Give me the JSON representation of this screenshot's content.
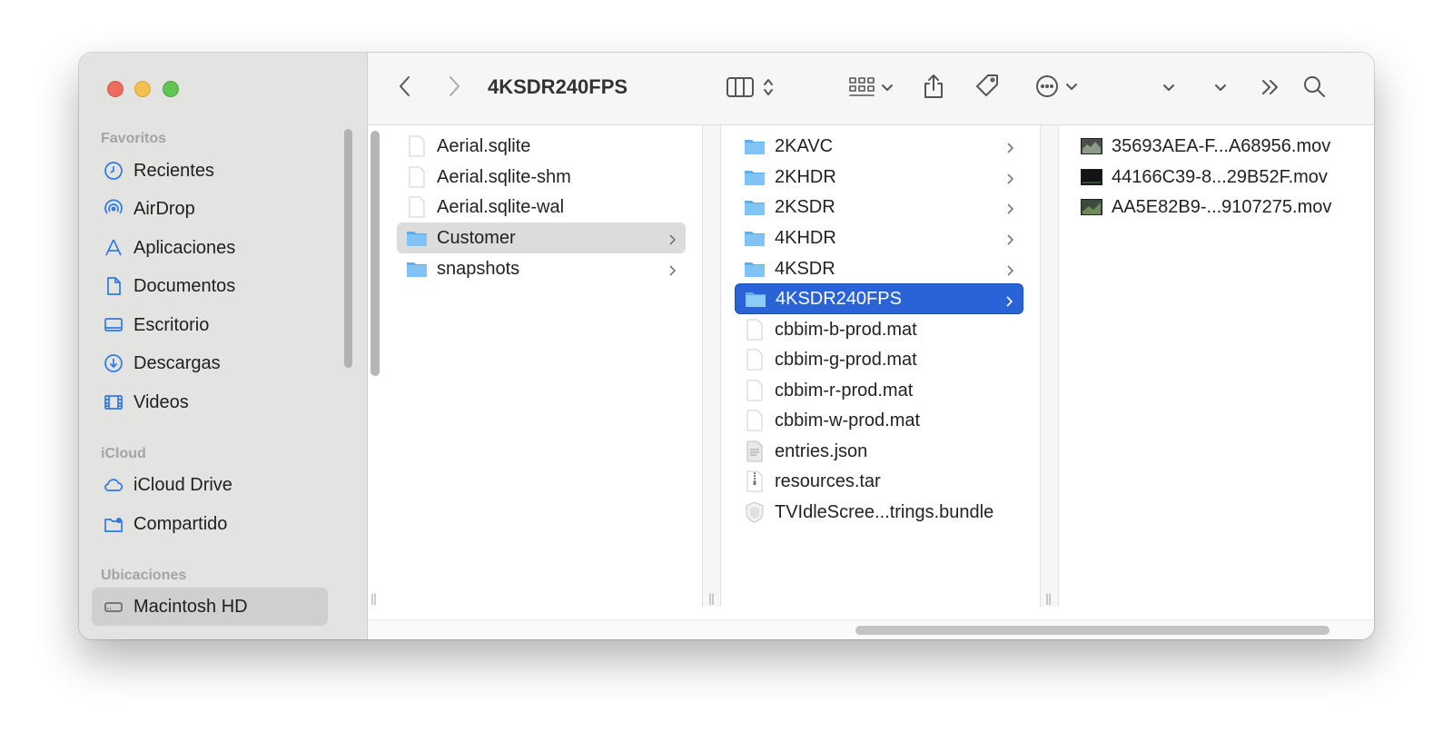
{
  "window": {
    "title": "4KSDR240FPS"
  },
  "sidebar": {
    "sections": [
      {
        "label": "Favoritos",
        "items": [
          {
            "label": "Recientes",
            "icon": "clock-icon"
          },
          {
            "label": "AirDrop",
            "icon": "airdrop-icon"
          },
          {
            "label": "Aplicaciones",
            "icon": "applications-icon"
          },
          {
            "label": "Documentos",
            "icon": "document-icon"
          },
          {
            "label": "Escritorio",
            "icon": "desktop-icon"
          },
          {
            "label": "Descargas",
            "icon": "download-icon"
          },
          {
            "label": "Videos",
            "icon": "film-icon"
          }
        ]
      },
      {
        "label": "iCloud",
        "items": [
          {
            "label": "iCloud Drive",
            "icon": "cloud-icon"
          },
          {
            "label": "Compartido",
            "icon": "shared-folder-icon"
          }
        ]
      },
      {
        "label": "Ubicaciones",
        "items": [
          {
            "label": "Macintosh HD",
            "icon": "hard-drive-icon",
            "selected": true
          }
        ]
      }
    ]
  },
  "columns": [
    {
      "items": [
        {
          "name": "Aerial.sqlite",
          "type": "file"
        },
        {
          "name": "Aerial.sqlite-shm",
          "type": "file"
        },
        {
          "name": "Aerial.sqlite-wal",
          "type": "file"
        },
        {
          "name": "Customer",
          "type": "folder",
          "state": "path"
        },
        {
          "name": "snapshots",
          "type": "folder"
        }
      ]
    },
    {
      "items": [
        {
          "name": "2KAVC",
          "type": "folder"
        },
        {
          "name": "2KHDR",
          "type": "folder"
        },
        {
          "name": "2KSDR",
          "type": "folder"
        },
        {
          "name": "4KHDR",
          "type": "folder"
        },
        {
          "name": "4KSDR",
          "type": "folder"
        },
        {
          "name": "4KSDR240FPS",
          "type": "folder",
          "state": "selected"
        },
        {
          "name": "cbbim-b-prod.mat",
          "type": "file"
        },
        {
          "name": "cbbim-g-prod.mat",
          "type": "file"
        },
        {
          "name": "cbbim-r-prod.mat",
          "type": "file"
        },
        {
          "name": "cbbim-w-prod.mat",
          "type": "file"
        },
        {
          "name": "entries.json",
          "type": "json-file"
        },
        {
          "name": "resources.tar",
          "type": "archive-file"
        },
        {
          "name": "TVIdleScree...trings.bundle",
          "type": "bundle"
        }
      ]
    },
    {
      "items": [
        {
          "name": "35693AEA-F...A68956.mov",
          "type": "video"
        },
        {
          "name": "44166C39-8...29B52F.mov",
          "type": "video"
        },
        {
          "name": "AA5E82B9-...9107275.mov",
          "type": "video"
        }
      ]
    }
  ],
  "colors": {
    "accent": "#2a62d8",
    "sidebar_bg": "#e3e3e2",
    "folder": "#5aaef0"
  }
}
